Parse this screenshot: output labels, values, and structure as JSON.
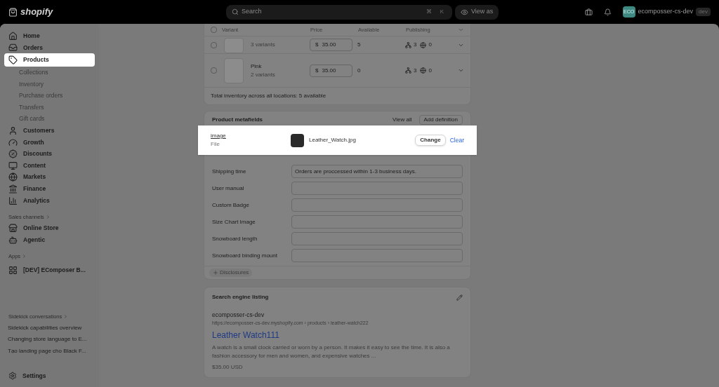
{
  "topbar": {
    "logo": "shopify",
    "search": {
      "placeholder": "Search",
      "keys": [
        "⌘",
        "K"
      ]
    },
    "view_as": "View as",
    "store": {
      "avatar": "ECO",
      "name": "ecomposser-cs-dev",
      "badge": "dev"
    }
  },
  "sidebar": {
    "items": [
      {
        "label": "Home",
        "kind": "main",
        "selected": false
      },
      {
        "label": "Orders",
        "kind": "main",
        "selected": false
      },
      {
        "label": "Products",
        "kind": "main",
        "selected": true
      },
      {
        "label": "Collections",
        "kind": "sub",
        "selected": false
      },
      {
        "label": "Inventory",
        "kind": "sub",
        "selected": false
      },
      {
        "label": "Purchase orders",
        "kind": "sub",
        "selected": false
      },
      {
        "label": "Transfers",
        "kind": "sub",
        "selected": false
      },
      {
        "label": "Gift cards",
        "kind": "sub",
        "selected": false
      },
      {
        "label": "Customers",
        "kind": "main",
        "selected": false
      },
      {
        "label": "Growth",
        "kind": "main",
        "selected": false
      },
      {
        "label": "Discounts",
        "kind": "main",
        "selected": false
      },
      {
        "label": "Content",
        "kind": "main",
        "selected": false
      },
      {
        "label": "Markets",
        "kind": "main",
        "selected": false
      },
      {
        "label": "Finance",
        "kind": "main",
        "selected": false
      },
      {
        "label": "Analytics",
        "kind": "main",
        "selected": false
      }
    ],
    "sections": [
      {
        "title": "Sales channels",
        "items": [
          "Online Store",
          "Agentic"
        ]
      },
      {
        "title": "Apps",
        "items": [
          "[DEV] EComposer B..."
        ]
      }
    ],
    "sidekick": {
      "title": "Sidekick conversations",
      "items": [
        "Sidekick capabilities overview",
        "Changing store language to E...",
        "Tạo landing page cho Black F..."
      ]
    },
    "settings": "Settings"
  },
  "variants": {
    "all_checked": false,
    "columns": [
      "Variant",
      "Price",
      "Available",
      "Publishing"
    ],
    "rows": [
      {
        "checked": false,
        "subtitle": "3 variants",
        "currency": "$",
        "price": "35.00",
        "available": "5",
        "channels": "3",
        "markets": "0"
      },
      {
        "checked": false,
        "name": "Pink",
        "subtitle": "2 variants",
        "currency": "$",
        "price": "35.00",
        "available": "0",
        "channels": "3",
        "markets": "0"
      }
    ],
    "total": "Total inventory across all locations: 5 available"
  },
  "metafields": {
    "title": "Product metafields",
    "view_all": "View all",
    "add": "Add definition",
    "highlighted": {
      "label": "image",
      "type": "File",
      "file": "Leather_Watch.jpg",
      "change": "Change",
      "clear": "Clear"
    },
    "fields": [
      {
        "label": "Shipping time",
        "value": "Orders are proccessed within 1-3 business days."
      },
      {
        "label": "User manual"
      },
      {
        "label": "Custom Badge"
      },
      {
        "label": "Size Chart Image"
      },
      {
        "label": "Snowboard length"
      },
      {
        "label": "Snowboard binding mount"
      }
    ],
    "disclosures": "Disclosures"
  },
  "seo": {
    "title": "Search engine listing",
    "store": "ecomposser-cs-dev",
    "url": "https://ecomposser-cs-dev.myshopify.com › products › leather-watch222",
    "page_title": "Leather Watch111",
    "description": "A watch is a small clock carried or worn by a person. It makes it easy to see the time. It is also a fashion accessory for men and women, and expensive watches ...",
    "price": "$35.00 USD"
  }
}
